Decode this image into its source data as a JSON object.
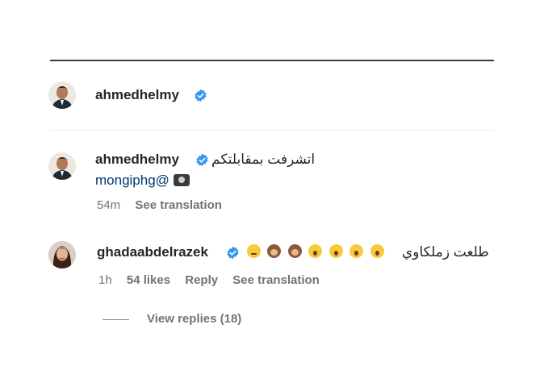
{
  "post_header": {
    "username": "ahmedhelmy"
  },
  "comments": [
    {
      "username": "ahmedhelmy",
      "text": "اتشرفت بمقابلتكم",
      "mention": "mongiphg@",
      "time": "54m",
      "see_translation": "See translation"
    },
    {
      "username": "ghadaabdelrazek",
      "text": "طلعت زملكاوي",
      "time": "1h",
      "likes": "54 likes",
      "reply": "Reply",
      "see_translation": "See translation",
      "view_replies": "View replies (18)"
    }
  ],
  "icons": {
    "verified": "verified-badge-icon",
    "camera": "camera-emoji-icon"
  },
  "colors": {
    "verified": "#3897f0",
    "mention": "#00376b",
    "meta": "#737373"
  }
}
